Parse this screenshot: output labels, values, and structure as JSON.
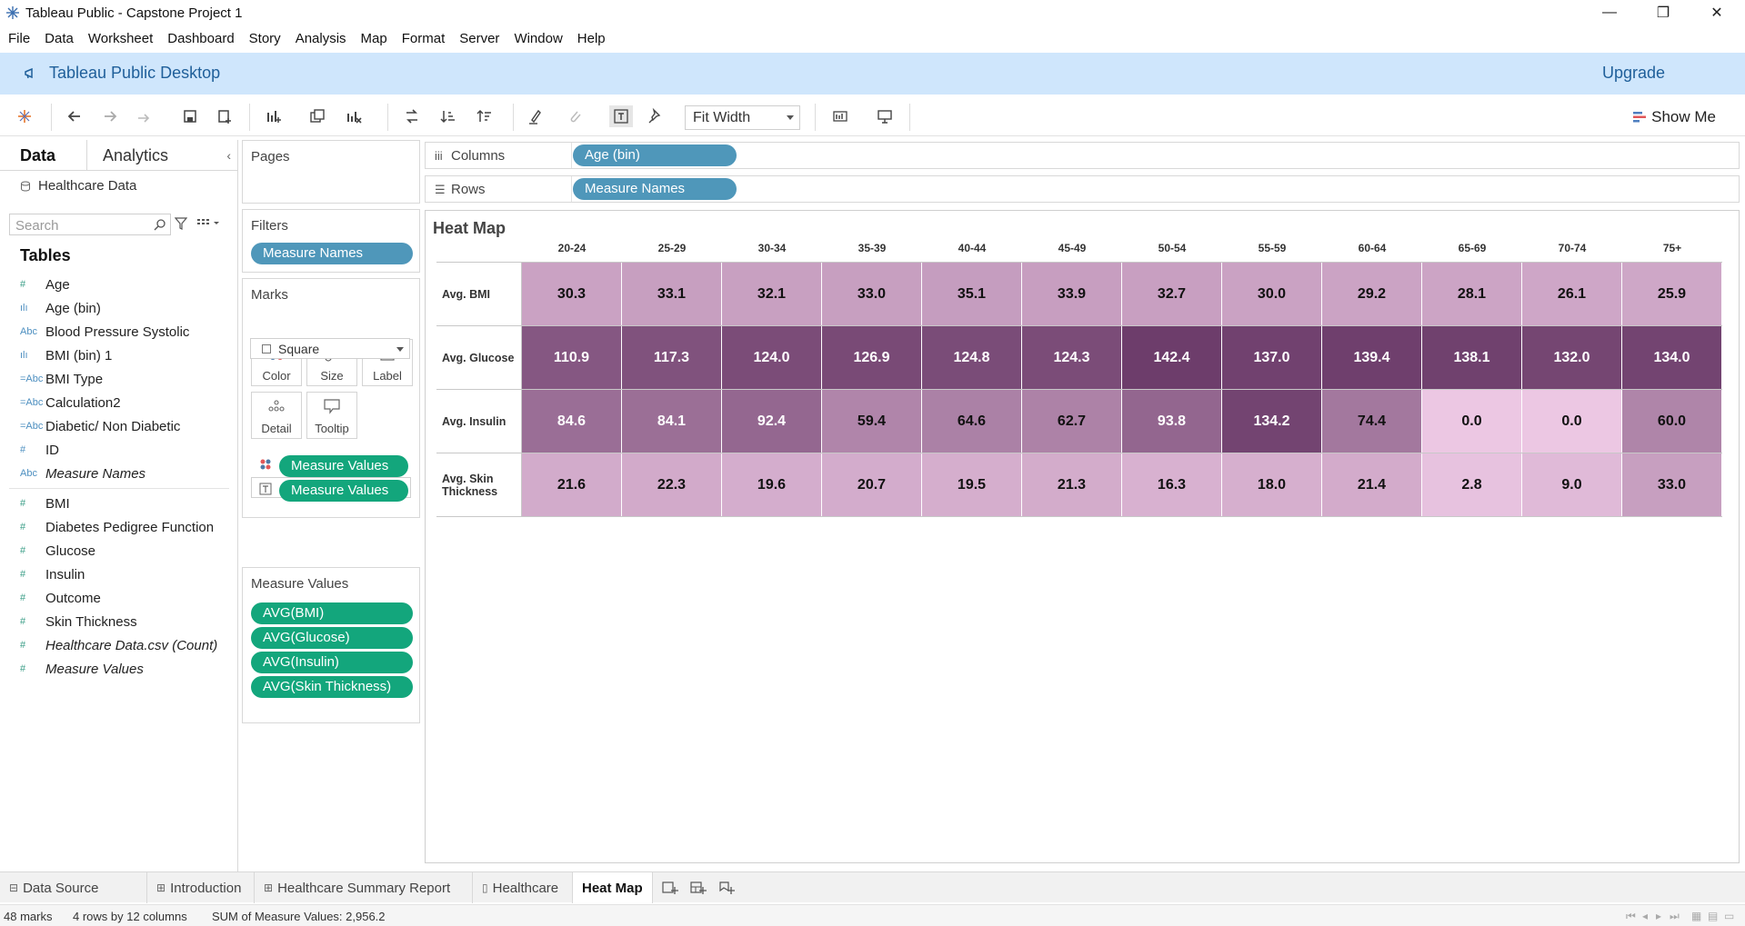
{
  "window": {
    "title": "Tableau Public - Capstone Project 1",
    "icons": [
      "tableau-logo-icon",
      "minimize-icon",
      "restore-icon",
      "close-icon"
    ]
  },
  "menu": [
    "File",
    "Data",
    "Worksheet",
    "Dashboard",
    "Story",
    "Analysis",
    "Map",
    "Format",
    "Server",
    "Window",
    "Help"
  ],
  "banner": {
    "title": "Tableau Public Desktop",
    "upgrade": "Upgrade",
    "color": "#cfe6fc"
  },
  "toolbar": {
    "fit_label": "Fit Width",
    "show_me": "Show Me"
  },
  "data_pane": {
    "tabs": [
      "Data",
      "Analytics"
    ],
    "datasource": "Healthcare Data",
    "search_placeholder": "Search",
    "tables_heading": "Tables",
    "dimensions": [
      {
        "icon": "#",
        "label": "Age",
        "italic": false
      },
      {
        "icon": "ılı",
        "label": "Age (bin)",
        "italic": false
      },
      {
        "icon": "Abc",
        "label": "Blood Pressure Systolic",
        "italic": false
      },
      {
        "icon": "ılı",
        "label": "BMI (bin) 1",
        "italic": false
      },
      {
        "icon": "=Abc",
        "label": "BMI Type",
        "italic": false
      },
      {
        "icon": "=Abc",
        "label": "Calculation2",
        "italic": false
      },
      {
        "icon": "=Abc",
        "label": "Diabetic/ Non Diabetic",
        "italic": false
      },
      {
        "icon": "#",
        "label": "ID",
        "italic": false
      },
      {
        "icon": "Abc",
        "label": "Measure Names",
        "italic": true
      }
    ],
    "measures": [
      {
        "icon": "#",
        "label": "BMI",
        "italic": false
      },
      {
        "icon": "#",
        "label": "Diabetes Pedigree Function",
        "italic": false
      },
      {
        "icon": "#",
        "label": "Glucose",
        "italic": false
      },
      {
        "icon": "#",
        "label": "Insulin",
        "italic": false
      },
      {
        "icon": "#",
        "label": "Outcome",
        "italic": false
      },
      {
        "icon": "#",
        "label": "Skin Thickness",
        "italic": false
      },
      {
        "icon": "#",
        "label": "Healthcare Data.csv (Count)",
        "italic": true
      },
      {
        "icon": "#",
        "label": "Measure Values",
        "italic": true
      }
    ]
  },
  "shelves": {
    "pages": "Pages",
    "filters": "Filters",
    "filter_pill": "Measure Names",
    "marks": "Marks",
    "mark_type": "Square",
    "mark_buttons": [
      "Color",
      "Size",
      "Label",
      "Detail",
      "Tooltip"
    ],
    "mark_pills": [
      "Measure Values",
      "Measure Values"
    ],
    "measure_values_title": "Measure Values",
    "measure_values": [
      "AVG(BMI)",
      "AVG(Glucose)",
      "AVG(Insulin)",
      "AVG(Skin Thickness)"
    ],
    "columns_label": "Columns",
    "columns_pill": "Age (bin)",
    "rows_label": "Rows",
    "rows_pill": "Measure Names"
  },
  "chart_data": {
    "type": "heatmap",
    "title": "Heat Map",
    "x": [
      "20-24",
      "25-29",
      "30-34",
      "35-39",
      "40-44",
      "45-49",
      "50-54",
      "55-59",
      "60-64",
      "65-69",
      "70-74",
      "75+"
    ],
    "y": [
      "Avg. BMI",
      "Avg. Glucose",
      "Avg. Insulin",
      "Avg. Skin Thickness"
    ],
    "values": [
      [
        "30.3",
        "33.1",
        "32.1",
        "33.0",
        "35.1",
        "33.9",
        "32.7",
        "30.0",
        "29.2",
        "28.1",
        "26.1",
        "25.9"
      ],
      [
        "110.9",
        "117.3",
        "124.0",
        "126.9",
        "124.8",
        "124.3",
        "142.4",
        "137.0",
        "139.4",
        "138.1",
        "132.0",
        "134.0"
      ],
      [
        "84.6",
        "84.1",
        "92.4",
        "59.4",
        "64.6",
        "62.7",
        "93.8",
        "134.2",
        "74.4",
        "0.0",
        "0.0",
        "60.0"
      ],
      [
        "21.6",
        "22.3",
        "19.6",
        "20.7",
        "19.5",
        "21.3",
        "16.3",
        "18.0",
        "21.4",
        "2.8",
        "9.0",
        "33.0"
      ]
    ],
    "color_scale": {
      "low": "#ecc7e3",
      "high": "#6d3d6b",
      "min": 0,
      "max": 142.4
    }
  },
  "sheet_tabs": [
    {
      "label": "Data Source",
      "icon": "⊟",
      "active": false
    },
    {
      "label": "Introduction",
      "icon": "⊞",
      "active": false
    },
    {
      "label": "Healthcare Summary Report",
      "icon": "⊞",
      "active": false
    },
    {
      "label": "Healthcare",
      "icon": "▯",
      "active": false
    },
    {
      "label": "Heat Map",
      "icon": "",
      "active": true
    }
  ],
  "status": {
    "marks": "48 marks",
    "dims": "4 rows by 12 columns",
    "sum": "SUM of Measure Values: 2,956.2"
  }
}
